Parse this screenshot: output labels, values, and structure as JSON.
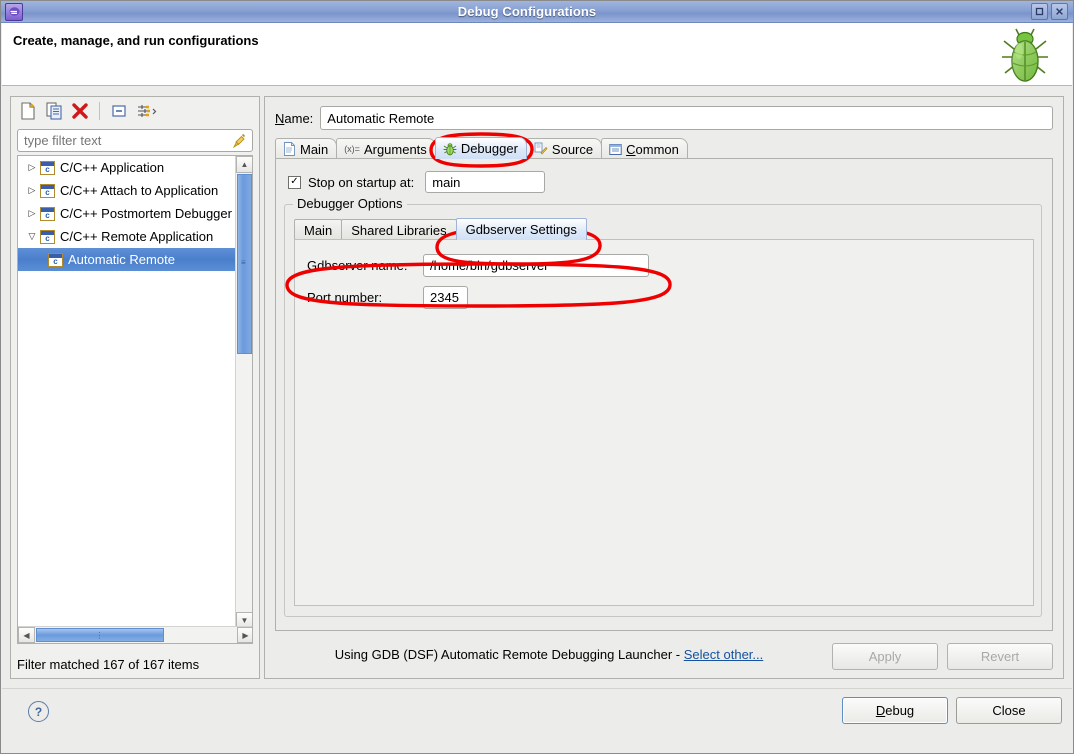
{
  "window": {
    "title": "Debug Configurations",
    "icon": "eclipse-icon",
    "buttons": [
      {
        "name": "maximize-button",
        "glyph": "□"
      },
      {
        "name": "close-button",
        "glyph": "×"
      }
    ]
  },
  "header": {
    "title": "Create, manage, and run configurations",
    "banner_icon": "bug-icon"
  },
  "left_panel": {
    "toolbar": [
      {
        "name": "new-configuration-button",
        "icon": "new-document-icon"
      },
      {
        "name": "duplicate-configuration-button",
        "icon": "copy-document-icon"
      },
      {
        "name": "delete-configuration-button",
        "icon": "red-x-delete-icon"
      },
      {
        "name": "collapse-all-button",
        "icon": "collapse-all-icon"
      },
      {
        "name": "filter-menu-button",
        "icon": "filter-arrows-icon"
      }
    ],
    "filter": {
      "placeholder": "type filter text",
      "value": "",
      "clear_icon": "broom-icon"
    },
    "tree": [
      {
        "label": "C/C++ Application",
        "expanded": false,
        "level": 0,
        "selected": false
      },
      {
        "label": "C/C++ Attach to Application",
        "expanded": false,
        "level": 0,
        "selected": false
      },
      {
        "label": "C/C++ Postmortem Debugger",
        "expanded": false,
        "level": 0,
        "selected": false
      },
      {
        "label": "C/C++ Remote Application",
        "expanded": true,
        "level": 0,
        "selected": false
      },
      {
        "label": "Automatic Remote",
        "expanded": null,
        "level": 1,
        "selected": true
      }
    ],
    "status": "Filter matched 167 of 167 items"
  },
  "right_panel": {
    "name_label": "Name:",
    "name_label_mnemonic": "N",
    "name_value": "Automatic Remote",
    "tabs": [
      {
        "label": "Main",
        "icon": "document-icon",
        "active": false,
        "mnemonic": ""
      },
      {
        "label": "Arguments",
        "icon": "arguments-icon",
        "active": false,
        "mnemonic": ""
      },
      {
        "label": "Debugger",
        "icon": "bug-icon",
        "active": true,
        "mnemonic": ""
      },
      {
        "label": "Source",
        "icon": "source-pencil-icon",
        "active": false,
        "mnemonic": ""
      },
      {
        "label": "Common",
        "icon": "common-icon",
        "active": false,
        "mnemonic": "C"
      }
    ],
    "stop_on_startup": {
      "label": "Stop on startup at:",
      "checked": true,
      "value": "main"
    },
    "group_title": "Debugger Options",
    "inner_tabs": [
      {
        "label": "Main",
        "active": false
      },
      {
        "label": "Shared Libraries",
        "active": false
      },
      {
        "label": "Gdbserver Settings",
        "active": true
      }
    ],
    "fields": [
      {
        "label": "Gdbserver name:",
        "value": "/home/bin/gdbserver"
      },
      {
        "label": "Port number:",
        "value": "2345"
      }
    ],
    "footer": {
      "launcher_prefix": "Using GDB (DSF) Automatic Remote Debugging Launcher - ",
      "launcher_link": "Select other...",
      "apply_label": "Apply",
      "apply_enabled": false,
      "revert_label": "Revert",
      "revert_enabled": false
    }
  },
  "bottom_bar": {
    "help_icon": "question-mark-help-icon",
    "debug_label": "Debug",
    "debug_mnemonic": "D",
    "close_label": "Close"
  },
  "annotations": {
    "color": "#ee0000",
    "shapes": [
      {
        "name": "debugger-tab-highlight"
      },
      {
        "name": "gdbserver-settings-tab-highlight"
      },
      {
        "name": "gdbserver-name-field-highlight"
      }
    ]
  }
}
